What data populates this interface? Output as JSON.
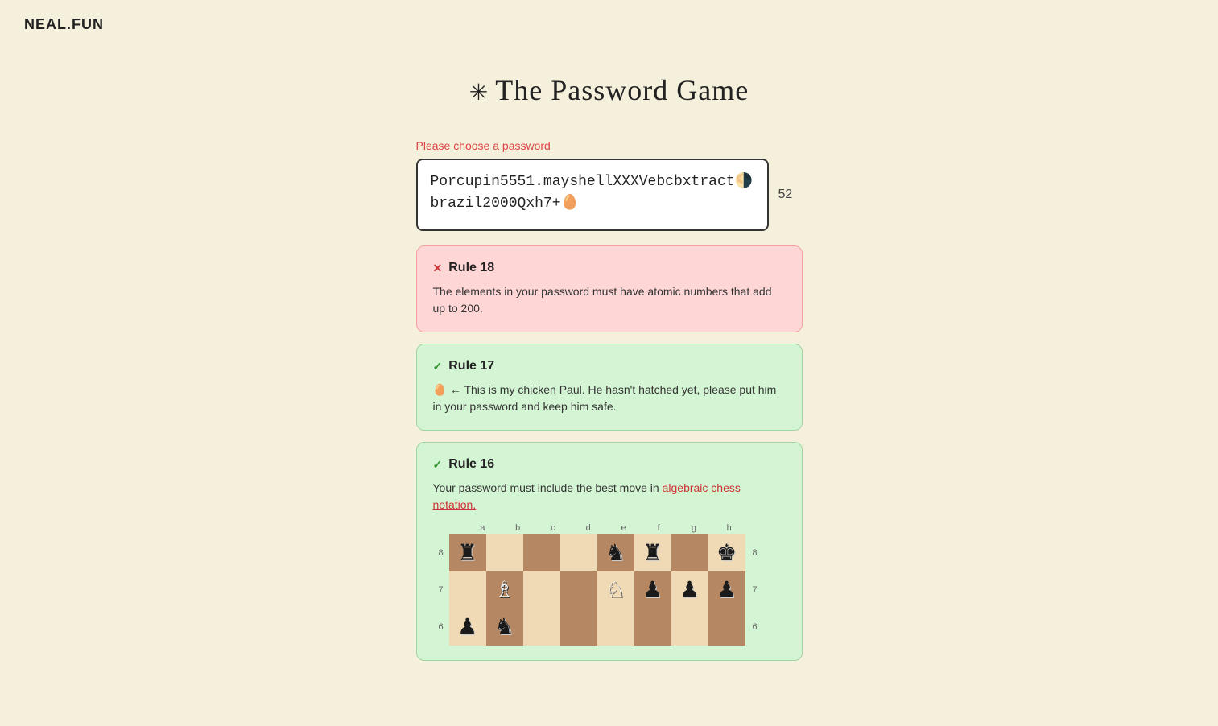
{
  "site": {
    "logo": "NEAL.FUN"
  },
  "page": {
    "title": "The Password Game",
    "star": "✳"
  },
  "password_section": {
    "label": "Please choose a password",
    "value": "Porcupin5551.mayshellXXXVebcbxtract🌗brazil2000Qxh7+🥚",
    "display_text": "Porcupin5551.mayshellXXXVebcbxtract🌗brazil2000Qxh7+🥚",
    "char_count": "52"
  },
  "rules": [
    {
      "id": "rule-18",
      "status": "failing",
      "title": "Rule 18",
      "body": "The elements in your password must have atomic numbers that add up to 200.",
      "status_icon": "✕",
      "link": null
    },
    {
      "id": "rule-17",
      "status": "passing",
      "title": "Rule 17",
      "body": "🥚 ← This is my chicken Paul. He hasn't hatched yet, please put him in your password and keep him safe.",
      "status_icon": "✓",
      "link": null
    },
    {
      "id": "rule-16",
      "status": "passing",
      "title": "Rule 16",
      "body_before_link": "Your password must include the best move in ",
      "link_text": "algebraic chess notation.",
      "body_after_link": "",
      "status_icon": "✓"
    }
  ],
  "chess_board": {
    "coords_top": [
      "a",
      "b",
      "c",
      "d",
      "e",
      "f",
      "g",
      "h"
    ],
    "coords_right": [
      "8",
      "7",
      "6"
    ],
    "rows": [
      {
        "coord": "8",
        "cells": [
          {
            "color": "dark",
            "piece": "♜",
            "piece_color": "black"
          },
          {
            "color": "light",
            "piece": "",
            "piece_color": ""
          },
          {
            "color": "dark",
            "piece": "",
            "piece_color": ""
          },
          {
            "color": "light",
            "piece": "",
            "piece_color": ""
          },
          {
            "color": "dark",
            "piece": "♞",
            "piece_color": "black"
          },
          {
            "color": "light",
            "piece": "♜",
            "piece_color": "black"
          },
          {
            "color": "dark",
            "piece": "",
            "piece_color": ""
          },
          {
            "color": "light",
            "piece": "♚",
            "piece_color": "black"
          }
        ]
      },
      {
        "coord": "7",
        "cells": [
          {
            "color": "light",
            "piece": "",
            "piece_color": ""
          },
          {
            "color": "dark",
            "piece": "♗",
            "piece_color": "white"
          },
          {
            "color": "light",
            "piece": "",
            "piece_color": ""
          },
          {
            "color": "dark",
            "piece": "",
            "piece_color": ""
          },
          {
            "color": "light",
            "piece": "♘",
            "piece_color": "white"
          },
          {
            "color": "dark",
            "piece": "♟",
            "piece_color": "black"
          },
          {
            "color": "light",
            "piece": "♟",
            "piece_color": "black"
          },
          {
            "color": "dark",
            "piece": "♟",
            "piece_color": "black"
          }
        ]
      },
      {
        "coord": "6",
        "cells": [
          {
            "color": "light",
            "piece": "♟",
            "piece_color": "black"
          },
          {
            "color": "dark",
            "piece": "♞",
            "piece_color": "black"
          },
          {
            "color": "light",
            "piece": "",
            "piece_color": ""
          },
          {
            "color": "dark",
            "piece": "",
            "piece_color": ""
          },
          {
            "color": "light",
            "piece": "",
            "piece_color": ""
          },
          {
            "color": "dark",
            "piece": "",
            "piece_color": ""
          },
          {
            "color": "light",
            "piece": "",
            "piece_color": ""
          },
          {
            "color": "dark",
            "piece": "",
            "piece_color": ""
          }
        ]
      }
    ]
  }
}
